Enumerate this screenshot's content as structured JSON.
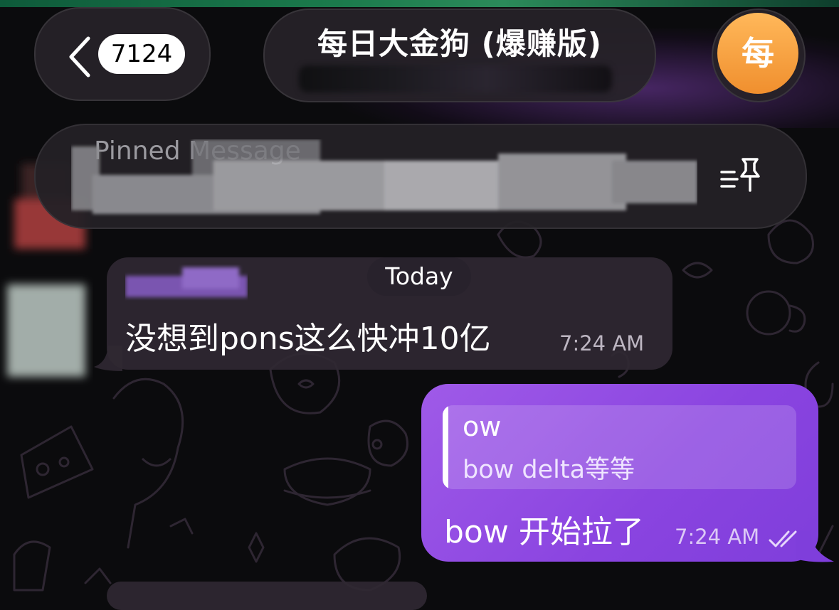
{
  "header": {
    "back_count": "7124",
    "title": "每日大金狗 (爆赚版)",
    "avatar_letter": "每"
  },
  "pinned": {
    "label": "Pinned Message"
  },
  "chat": {
    "date_separator": "Today",
    "incoming": {
      "text": "没想到pons这么快冲10亿",
      "time": "7:24 AM"
    },
    "outgoing": {
      "reply_name": "ow",
      "reply_text": "bow delta等等",
      "text": "bow 开始拉了",
      "time": "7:24 AM"
    }
  },
  "colors": {
    "background": "#0b0b0d",
    "outgoing_bubble": "#8a44e0",
    "incoming_bubble": "#302832",
    "avatar": "#f6a23e"
  }
}
